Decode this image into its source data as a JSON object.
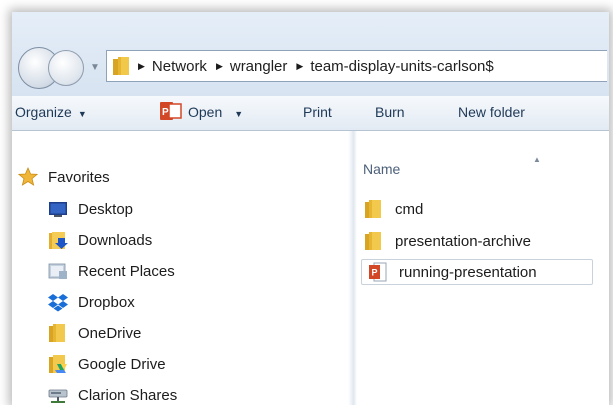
{
  "address_bar": {
    "breadcrumbs": [
      "Network",
      "wrangler",
      "team-display-units-carlson$"
    ]
  },
  "toolbar": {
    "organize_label": "Organize",
    "open_label": "Open",
    "print_label": "Print",
    "burn_label": "Burn",
    "new_folder_label": "New folder"
  },
  "nav_pane": {
    "items": [
      {
        "label": "Favorites",
        "icon": "star-icon"
      },
      {
        "label": "Desktop",
        "icon": "desktop-icon"
      },
      {
        "label": "Downloads",
        "icon": "downloads-icon"
      },
      {
        "label": "Recent Places",
        "icon": "recent-places-icon"
      },
      {
        "label": "Dropbox",
        "icon": "dropbox-icon"
      },
      {
        "label": "OneDrive",
        "icon": "folder-icon"
      },
      {
        "label": "Google Drive",
        "icon": "google-drive-icon"
      },
      {
        "label": "Clarion Shares",
        "icon": "network-drive-icon"
      }
    ]
  },
  "content": {
    "column_header": "Name",
    "files": [
      {
        "name": "cmd",
        "icon": "folder-icon"
      },
      {
        "name": "presentation-archive",
        "icon": "folder-icon"
      },
      {
        "name": "running-presentation",
        "icon": "powerpoint-file-icon"
      }
    ]
  },
  "colors": {
    "toolbar_text": "#1e3957",
    "folder_yellow": "#e8b83c",
    "powerpoint_red": "#d24726",
    "selection_border": "#c9d2dc"
  }
}
